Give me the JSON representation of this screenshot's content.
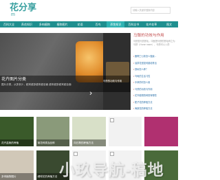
{
  "site": {
    "logo": "花分享",
    "logo_sub": "m",
    "search_placeholder": "请输入关键字搜索内容"
  },
  "nav": [
    "百科大全",
    "养花知识",
    "多肉植物",
    "植物图片",
    "花语",
    "百鸟",
    "养鱼知识",
    "百科全书",
    "花卉花草",
    "图文"
  ],
  "hero": {
    "left_caption": "",
    "section_title": "花卉图片分类",
    "section_desc": "图片分类，从多到少，越来越多越来越全面 越来越多越来越全面",
    "right_caption": "马鬃的功效与作用"
  },
  "side": {
    "title": "马鬃的功效与作用",
    "desc": "马鬃是马的鬃毛，中医把马鬃的鬃毛称之为马鬃（Horse mane），马鬃可以入药",
    "items": [
      "鹿啊三七粉怎么做最...",
      "油茶花是如何被培育出",
      "铁树怎么养？",
      "乌龟的生活习性",
      "中草药材怎么用",
      "马鬃的功效与作用",
      "花卉植物的种类有哪些",
      "栀子花的养殖方法",
      "海棠花的养殖方法"
    ]
  },
  "gallery": [
    {
      "caption": "花卉盆栽的养殖",
      "color": "#3a5a2a"
    },
    {
      "caption": "菊花种类及品种",
      "color": "#8a9a7a"
    },
    {
      "caption": "向日葵的养殖方法",
      "color": "#d8e0c8"
    },
    {
      "caption": "",
      "color": "#f2f2f2"
    },
    {
      "caption": "",
      "color": "#b03070"
    },
    {
      "caption": "多肉植物图片",
      "color": "#d1c8b8"
    },
    {
      "caption": "绣球花的养殖方法",
      "color": "#3a4a30"
    },
    {
      "caption": "",
      "color": "#f2f2f2"
    },
    {
      "caption": "",
      "color": "#f2f2f2"
    },
    {
      "caption": "",
      "color": "#4a6a3a"
    }
  ],
  "watermark": "小玖导航-稿地"
}
